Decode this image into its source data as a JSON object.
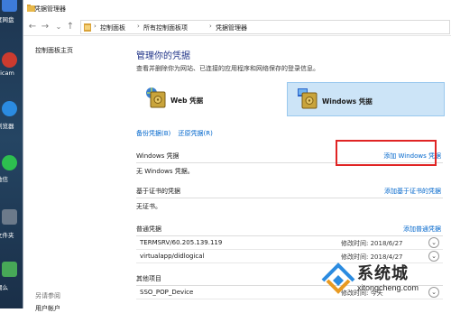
{
  "desktop": {
    "icons": [
      {
        "label": "度网盘",
        "color": "#3d7bd9"
      },
      {
        "label": "dicam",
        "color": "#cc3b2f"
      },
      {
        "label": "浏览器",
        "color": "#2b8be0"
      },
      {
        "label": "微信",
        "color": "#2dbf4f"
      },
      {
        "label": "文件夹",
        "color": "#6c7a8a"
      },
      {
        "label": "潮么",
        "color": "#47a857"
      }
    ]
  },
  "window": {
    "title": "凭据管理器",
    "nav": {
      "back": "←",
      "forward": "→",
      "recent": "⌄",
      "up": "↑"
    },
    "breadcrumbs": [
      "控制面板",
      "所有控制面板项",
      "凭据管理器"
    ],
    "crumb_separator": "›"
  },
  "sidebar": {
    "home": "控制面板主页",
    "see_also": "另请参阅",
    "user_accounts": "用户帐户"
  },
  "main": {
    "heading": "管理你的凭据",
    "subtitle": "查看并删除你为网站、已连接的应用程序和网络保存的登录信息。",
    "tiles": [
      {
        "label": "Web 凭据"
      },
      {
        "label": "Windows 凭据"
      }
    ],
    "backup_link": "备份凭据(B)",
    "restore_link": "还原凭据(R)",
    "windows_section": {
      "title": "Windows 凭据",
      "add_link": "添加 Windows 凭据",
      "empty_text": "无 Windows 凭据。"
    },
    "cert_section": {
      "title": "基于证书的凭据",
      "add_link": "添加基于证书的凭据",
      "empty_text": "无证书。"
    },
    "generic_section": {
      "title": "普通凭据",
      "add_link": "添加普通凭据",
      "items": [
        {
          "name": "TERMSRV/60.205.139.119",
          "modified": "修改时间: 2018/6/27"
        },
        {
          "name": "virtualapp/didlogical",
          "modified": "修改时间: 2018/4/27"
        }
      ]
    },
    "other_section": {
      "title": "其他项目",
      "items": [
        {
          "name": "SSO_POP_Device",
          "modified": "修改时间: 今天"
        }
      ]
    },
    "chevron": "⌄"
  },
  "watermark": {
    "brand": "系统城",
    "url": "xitongcheng.com",
    "accent": "#2b8be0"
  },
  "colors": {
    "link": "#0066cc",
    "heading": "#1e3287",
    "selected_tile": "#cce4f7",
    "highlight": "#e02424"
  }
}
